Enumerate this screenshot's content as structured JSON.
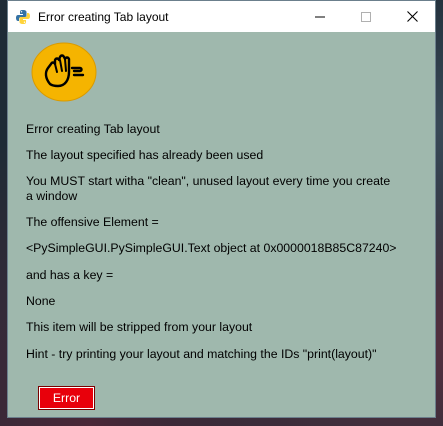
{
  "window": {
    "title": "Error creating Tab layout",
    "controls": {
      "minimize": "minimize-icon",
      "maximize": "maximize-icon",
      "close": "close-icon"
    },
    "icon": "python-logo-icon"
  },
  "body": {
    "emoji": "waving-hand-emoji-icon",
    "lines": [
      "Error creating Tab layout",
      "The layout specified has already been used",
      "You MUST start witha \"clean\", unused layout every time you create a window",
      "The offensive Element =",
      "<PySimpleGUI.PySimpleGUI.Text object at 0x0000018B85C87240>",
      "and has a key =",
      "None",
      "This item will be stripped from your layout",
      "Hint - try printing your layout and matching the IDs \"print(layout)\""
    ]
  },
  "button": {
    "label": "Error"
  },
  "colors": {
    "window_bg": "#9fb8ad",
    "button_bg": "#e8000b",
    "button_text": "#ffffff",
    "emoji_yellow": "#f5b400"
  }
}
